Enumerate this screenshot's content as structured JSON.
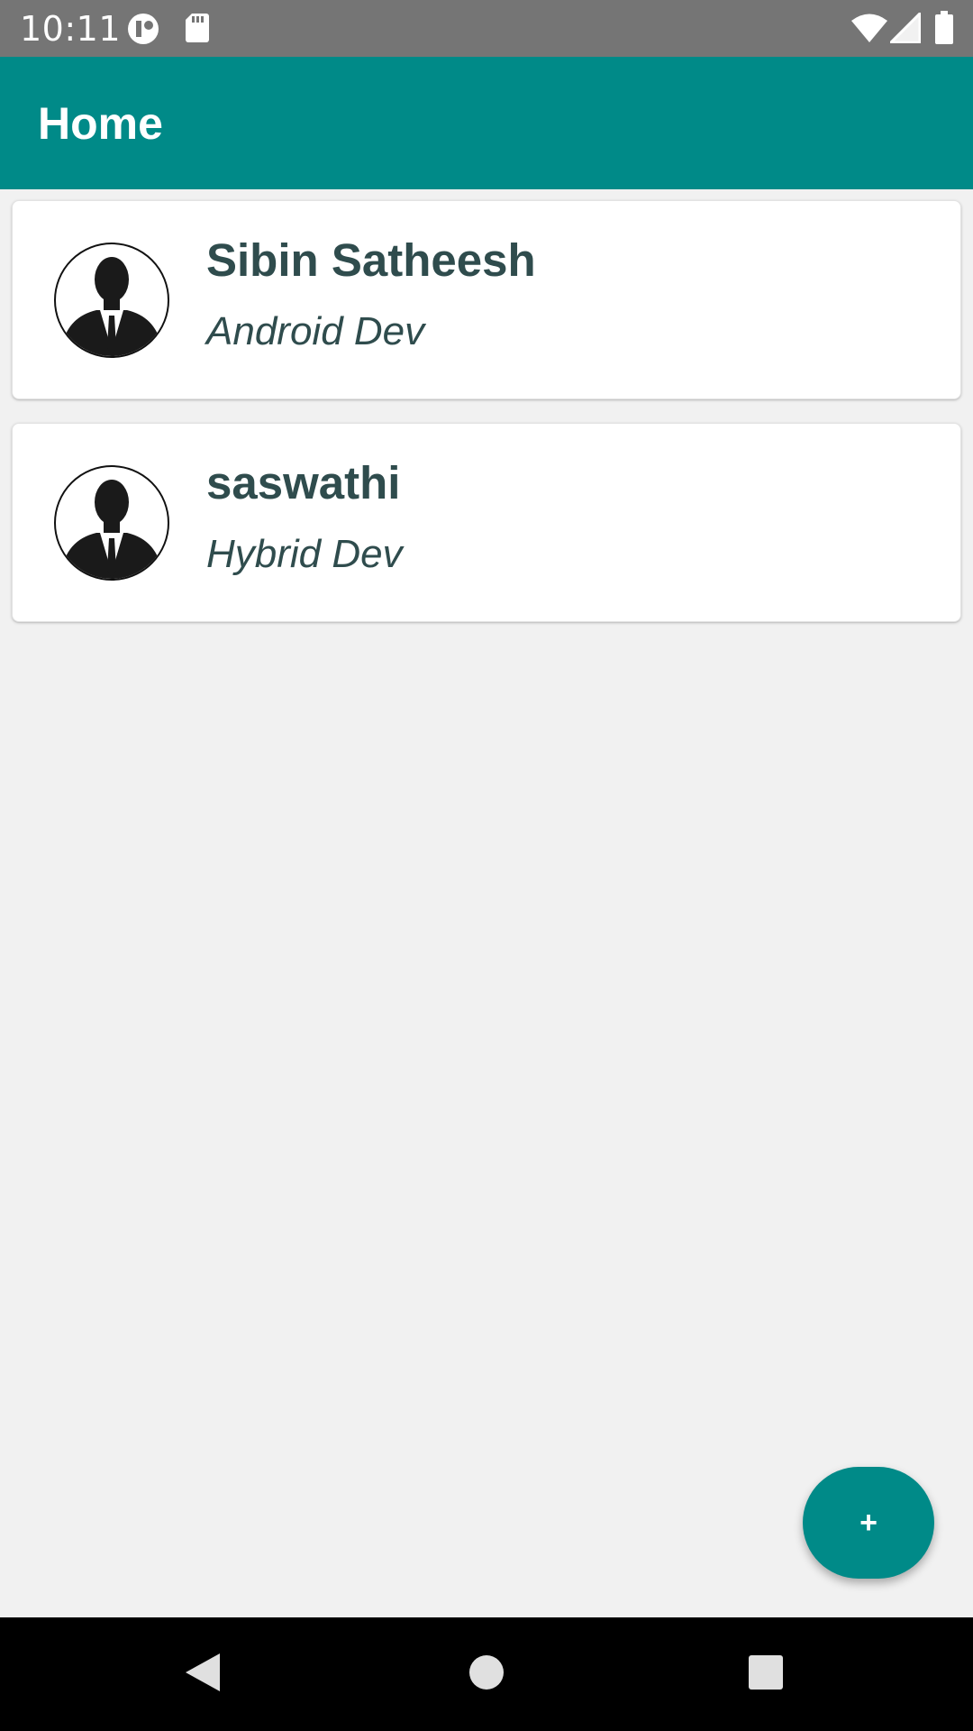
{
  "status_bar": {
    "time": "10:11",
    "icons": [
      "notification-app-icon",
      "sd-card-icon",
      "wifi-icon",
      "cell-signal-icon",
      "battery-icon"
    ]
  },
  "app_bar": {
    "title": "Home",
    "color": "#008a88"
  },
  "contacts": [
    {
      "name": "Sibin Satheesh",
      "role": "Android Dev",
      "avatar": "person-silhouette-icon"
    },
    {
      "name": "saswathi",
      "role": "Hybrid Dev",
      "avatar": "person-silhouette-icon"
    }
  ],
  "fab": {
    "label": "+",
    "icon": "add-icon"
  },
  "nav_bar": {
    "buttons": [
      "back-icon",
      "home-icon",
      "recents-icon"
    ]
  },
  "colors": {
    "accent": "#008a88",
    "status_bar": "#757575",
    "background": "#f1f1f1",
    "text": "#2f4c4d"
  }
}
